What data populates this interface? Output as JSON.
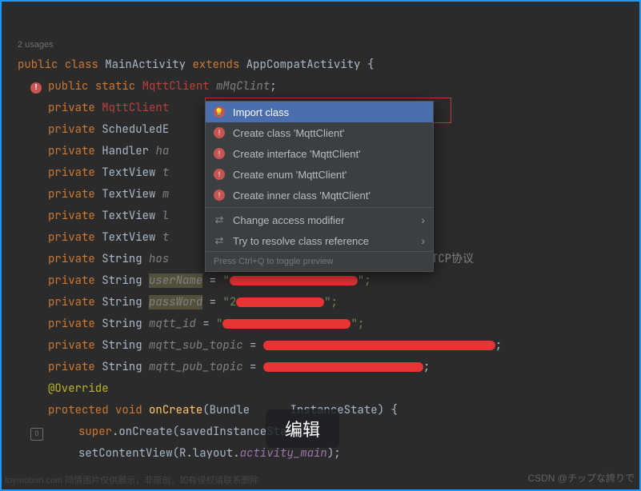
{
  "hint": {
    "usages": "2 usages"
  },
  "gutter": {
    "error_glyph": "!"
  },
  "code": {
    "l1": {
      "kw1": "public",
      "kw2": "class",
      "name": "MainActivity",
      "kw3": "extends",
      "base": "AppCompatActivity",
      "open": " {"
    },
    "l2": {
      "kw1": "public",
      "kw2": "static",
      "type": "MqttClient",
      "field": "mMqClint",
      "end": ";"
    },
    "l3": {
      "kw": "private",
      "type": "MqttClien",
      "trail": "t"
    },
    "l4": {
      "kw": "private",
      "type": "ScheduledE"
    },
    "l5": {
      "kw": "private",
      "type": "Handler",
      "field": "ha"
    },
    "l6": {
      "kw": "private",
      "type": "TextView",
      "field": "t"
    },
    "l7": {
      "kw": "private",
      "type": "TextView",
      "field": "m"
    },
    "l8": {
      "kw": "private",
      "type": "TextView",
      "field": "l"
    },
    "l9": {
      "kw": "private",
      "type": "TextView",
      "field": "t"
    },
    "l10": {
      "kw": "private",
      "type": "String",
      "field": "hos",
      "comment": "// TCP协议"
    },
    "l11": {
      "kw": "private",
      "type": "String",
      "field": "userName",
      "eq": " = ",
      "q1": "\"",
      "q2": "\";"
    },
    "l12": {
      "kw": "private",
      "type": "String",
      "field": "passWord",
      "eq": " = ",
      "q1": "\"2",
      "q2": "\";"
    },
    "l13": {
      "kw": "private",
      "type": "String",
      "field": "mqtt_id",
      "eq": " = ",
      "q1": "\"",
      "q2": "\";"
    },
    "l14": {
      "kw": "private",
      "type": "String",
      "field": "mqtt_sub_topic",
      "eq": " = ",
      "q2": ";"
    },
    "l15": {
      "kw": "private",
      "type": "String",
      "field": "mqtt_pub_topic",
      "eq": " = ",
      "q2": ";"
    },
    "l16": {
      "ann": "@Override"
    },
    "l17": {
      "kw1": "protected",
      "kw2": "void",
      "method": "onCreate",
      "args_open": "(Bundle ",
      "arg_hidden": "InstanceState)",
      "open": " {"
    },
    "l18": {
      "kw": "super",
      "call": ".onCreate(savedInstanceState);"
    },
    "l19": {
      "call_a": "setContentView(R.layout.",
      "layout": "activity_main",
      "call_b": ");"
    }
  },
  "popup": {
    "items": [
      {
        "label": "Import class",
        "icon": "bulb",
        "selected": true
      },
      {
        "label": "Create class 'MqttClient'",
        "icon": "bulb"
      },
      {
        "label": "Create interface 'MqttClient'",
        "icon": "bulb"
      },
      {
        "label": "Create enum 'MqttClient'",
        "icon": "bulb"
      },
      {
        "label": "Create inner class 'MqttClient'",
        "icon": "bulb"
      },
      {
        "separator": true
      },
      {
        "label": "Change access modifier",
        "icon": "intent",
        "submenu": true
      },
      {
        "label": "Try to resolve class reference",
        "icon": "intent",
        "submenu": true
      }
    ],
    "footer": "Press Ctrl+Q to toggle preview"
  },
  "pill": {
    "label": "编辑"
  },
  "watermark": {
    "right": "CSDN @チップな誇りで",
    "left": "toymoban.com 同情图片仅供展示，非原创，如有侵权请联系删除"
  }
}
